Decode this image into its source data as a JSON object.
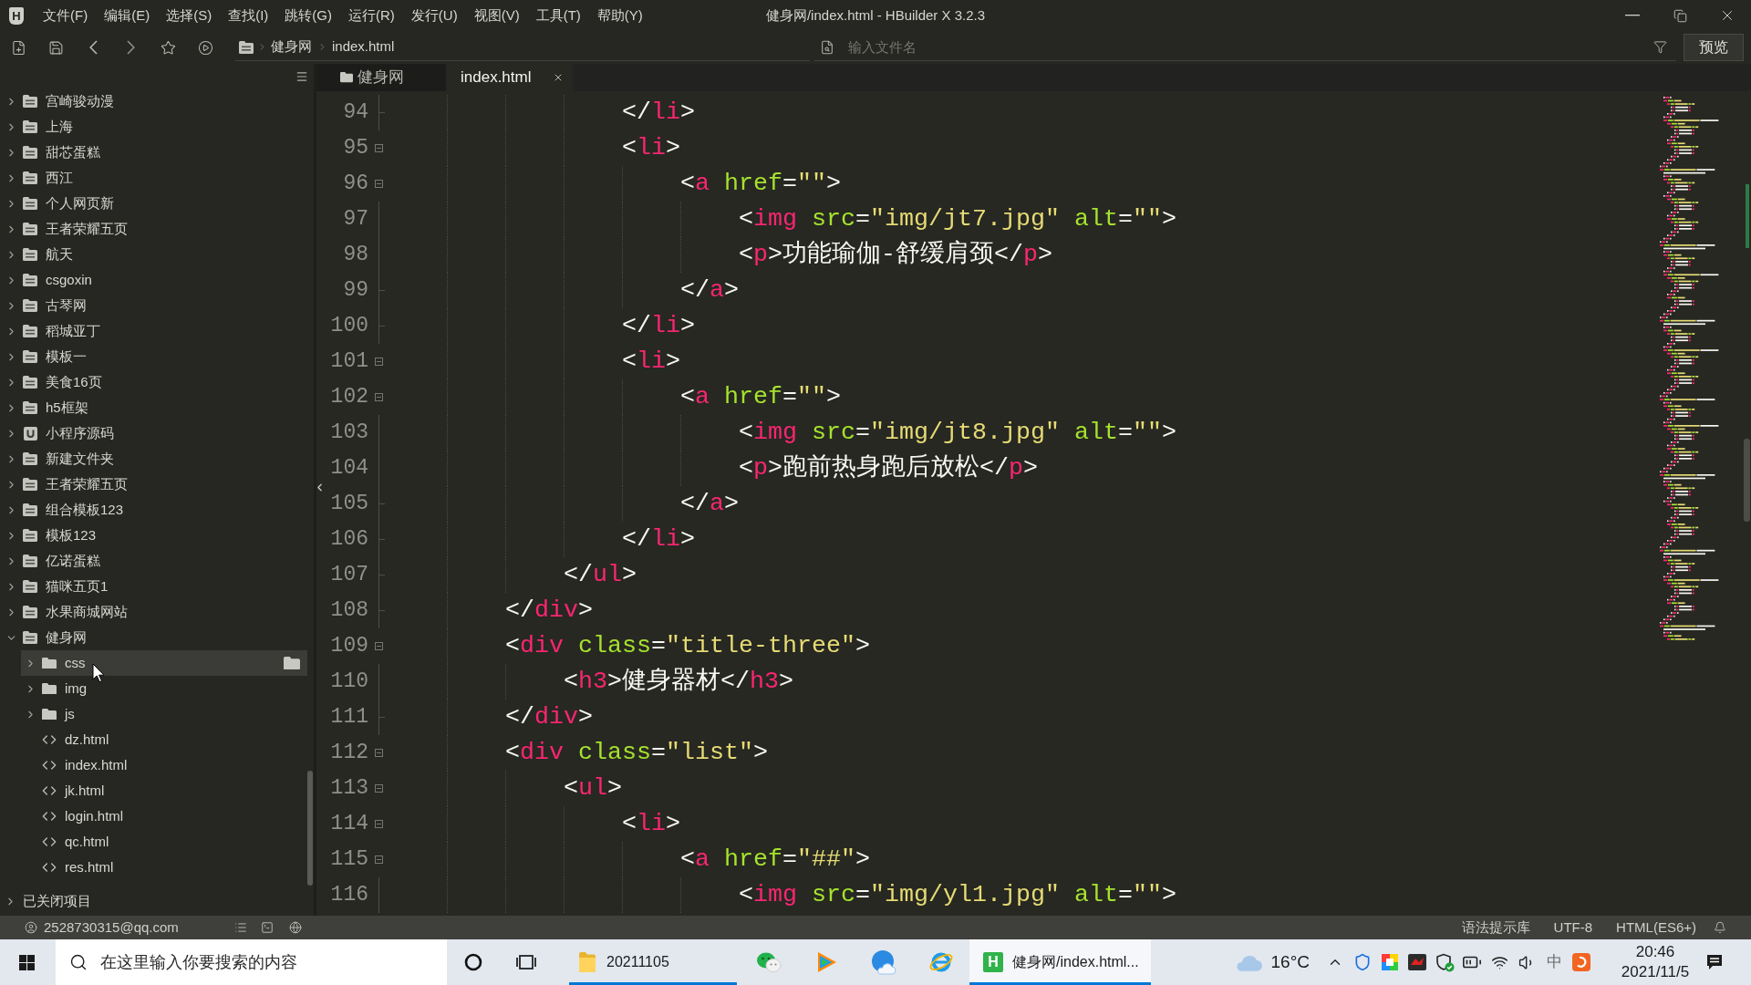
{
  "title_bar": {
    "logo": "H",
    "menus": [
      "文件(F)",
      "编辑(E)",
      "选择(S)",
      "查找(I)",
      "跳转(G)",
      "运行(R)",
      "发行(U)",
      "视图(V)",
      "工具(T)",
      "帮助(Y)"
    ],
    "title": "健身网/index.html - HBuilder X 3.2.3"
  },
  "toolbar": {
    "breadcrumb": [
      "健身网",
      "index.html"
    ],
    "file_search": {
      "placeholder": "输入文件名"
    },
    "preview_button": "预览"
  },
  "sidebar": {
    "items": [
      {
        "label": "宫崎骏动漫",
        "kind": "project",
        "expanded": false,
        "selected": false
      },
      {
        "label": "上海",
        "kind": "project",
        "expanded": false,
        "selected": false
      },
      {
        "label": "甜芯蛋糕",
        "kind": "project",
        "expanded": false,
        "selected": false
      },
      {
        "label": "西江",
        "kind": "project",
        "expanded": false,
        "selected": false
      },
      {
        "label": "个人网页新",
        "kind": "project",
        "expanded": false,
        "selected": false
      },
      {
        "label": "王者荣耀五页",
        "kind": "project",
        "expanded": false,
        "selected": false
      },
      {
        "label": "航天",
        "kind": "project",
        "expanded": false,
        "selected": false
      },
      {
        "label": "csgoxin",
        "kind": "project",
        "expanded": false,
        "selected": false
      },
      {
        "label": "古琴网",
        "kind": "project",
        "expanded": false,
        "selected": false
      },
      {
        "label": "稻城亚丁",
        "kind": "project",
        "expanded": false,
        "selected": false
      },
      {
        "label": "模板一",
        "kind": "project",
        "expanded": false,
        "selected": false
      },
      {
        "label": "美食16页",
        "kind": "project",
        "expanded": false,
        "selected": false
      },
      {
        "label": "h5框架",
        "kind": "project",
        "expanded": false,
        "selected": false
      },
      {
        "label": "小程序源码",
        "kind": "app-project",
        "expanded": false,
        "selected": false
      },
      {
        "label": "新建文件夹",
        "kind": "project",
        "expanded": false,
        "selected": false
      },
      {
        "label": "王者荣耀五页",
        "kind": "project",
        "expanded": false,
        "selected": false
      },
      {
        "label": "组合模板123",
        "kind": "project",
        "expanded": false,
        "selected": false
      },
      {
        "label": "模板123",
        "kind": "project",
        "expanded": false,
        "selected": false
      },
      {
        "label": "亿诺蛋糕",
        "kind": "project",
        "expanded": false,
        "selected": false
      },
      {
        "label": "猫咪五页1",
        "kind": "project",
        "expanded": false,
        "selected": false
      },
      {
        "label": "水果商城网站",
        "kind": "project",
        "expanded": false,
        "selected": false
      },
      {
        "label": "健身网",
        "kind": "project",
        "expanded": true,
        "selected": false,
        "children": [
          {
            "label": "css",
            "kind": "folder",
            "expanded": false,
            "selected": true
          },
          {
            "label": "img",
            "kind": "folder",
            "expanded": false,
            "selected": false
          },
          {
            "label": "js",
            "kind": "folder",
            "expanded": false,
            "selected": false
          },
          {
            "label": "dz.html",
            "kind": "file",
            "selected": false
          },
          {
            "label": "index.html",
            "kind": "file",
            "selected": false
          },
          {
            "label": "jk.html",
            "kind": "file",
            "selected": false
          },
          {
            "label": "login.html",
            "kind": "file",
            "selected": false
          },
          {
            "label": "qc.html",
            "kind": "file",
            "selected": false
          },
          {
            "label": "res.html",
            "kind": "file",
            "selected": false
          }
        ]
      }
    ],
    "closed_projects": {
      "label": "已关闭项目",
      "expanded": false
    }
  },
  "editor_tabs": [
    {
      "label": "健身网",
      "kind": "project",
      "selected": false
    },
    {
      "label": "index.html",
      "kind": "file",
      "selected": true
    }
  ],
  "editor": {
    "lines": [
      {
        "number": "94",
        "kind": "end",
        "text": "                </li>"
      },
      {
        "number": "95",
        "kind": "start",
        "text": "                <li>"
      },
      {
        "number": "96",
        "kind": "start",
        "text": "                    <a href=\"\">"
      },
      {
        "number": "97",
        "kind": "inner",
        "text": "                        <img src=\"img/jt7.jpg\" alt=\"\">"
      },
      {
        "number": "98",
        "kind": "inner",
        "text": "                        <p>功能瑜伽-舒缓肩颈</p>"
      },
      {
        "number": "99",
        "kind": "end",
        "text": "                    </a>"
      },
      {
        "number": "100",
        "kind": "end",
        "text": "                </li>"
      },
      {
        "number": "101",
        "kind": "start",
        "text": "                <li>"
      },
      {
        "number": "102",
        "kind": "start",
        "text": "                    <a href=\"\">"
      },
      {
        "number": "103",
        "kind": "inner",
        "text": "                        <img src=\"img/jt8.jpg\" alt=\"\">"
      },
      {
        "number": "104",
        "kind": "inner",
        "text": "                        <p>跑前热身跑后放松</p>"
      },
      {
        "number": "105",
        "kind": "end",
        "text": "                    </a>"
      },
      {
        "number": "106",
        "kind": "end",
        "text": "                </li>"
      },
      {
        "number": "107",
        "kind": "end",
        "text": "            </ul>"
      },
      {
        "number": "108",
        "kind": "end",
        "text": "        </div>"
      },
      {
        "number": "109",
        "kind": "start",
        "text": "        <div class=\"title-three\">"
      },
      {
        "number": "110",
        "kind": "inner",
        "text": "            <h3>健身器材</h3>"
      },
      {
        "number": "111",
        "kind": "end",
        "text": "        </div>"
      },
      {
        "number": "112",
        "kind": "start",
        "text": "        <div class=\"list\">"
      },
      {
        "number": "113",
        "kind": "start",
        "text": "            <ul>"
      },
      {
        "number": "114",
        "kind": "start",
        "text": "                <li>"
      },
      {
        "number": "115",
        "kind": "start",
        "text": "                    <a href=\"##\">"
      },
      {
        "number": "116",
        "kind": "inner",
        "text": "                        <img src=\"img/yl1.jpg\" alt=\"\">"
      }
    ]
  },
  "status_bar": {
    "account": "2528730315@qq.com",
    "items": [
      "语法提示库",
      "UTF-8",
      "HTML(ES6+)"
    ]
  },
  "taskbar": {
    "search": {
      "placeholder": "在这里输入你要搜索的内容"
    },
    "items": [
      {
        "kind": "folder",
        "label": "20211105",
        "running": true,
        "selected": false
      },
      {
        "kind": "chat",
        "running": false,
        "selected": false
      },
      {
        "kind": "video",
        "running": false,
        "selected": false
      },
      {
        "kind": "cloud",
        "running": false,
        "selected": false
      },
      {
        "kind": "browser",
        "running": false,
        "selected": false
      },
      {
        "kind": "editor",
        "logo": "H",
        "label": "健身网/index.html...",
        "running": true,
        "selected": true
      }
    ],
    "weather": "16°C",
    "ime": "中",
    "time": "20:46",
    "date": "2021/11/5"
  }
}
